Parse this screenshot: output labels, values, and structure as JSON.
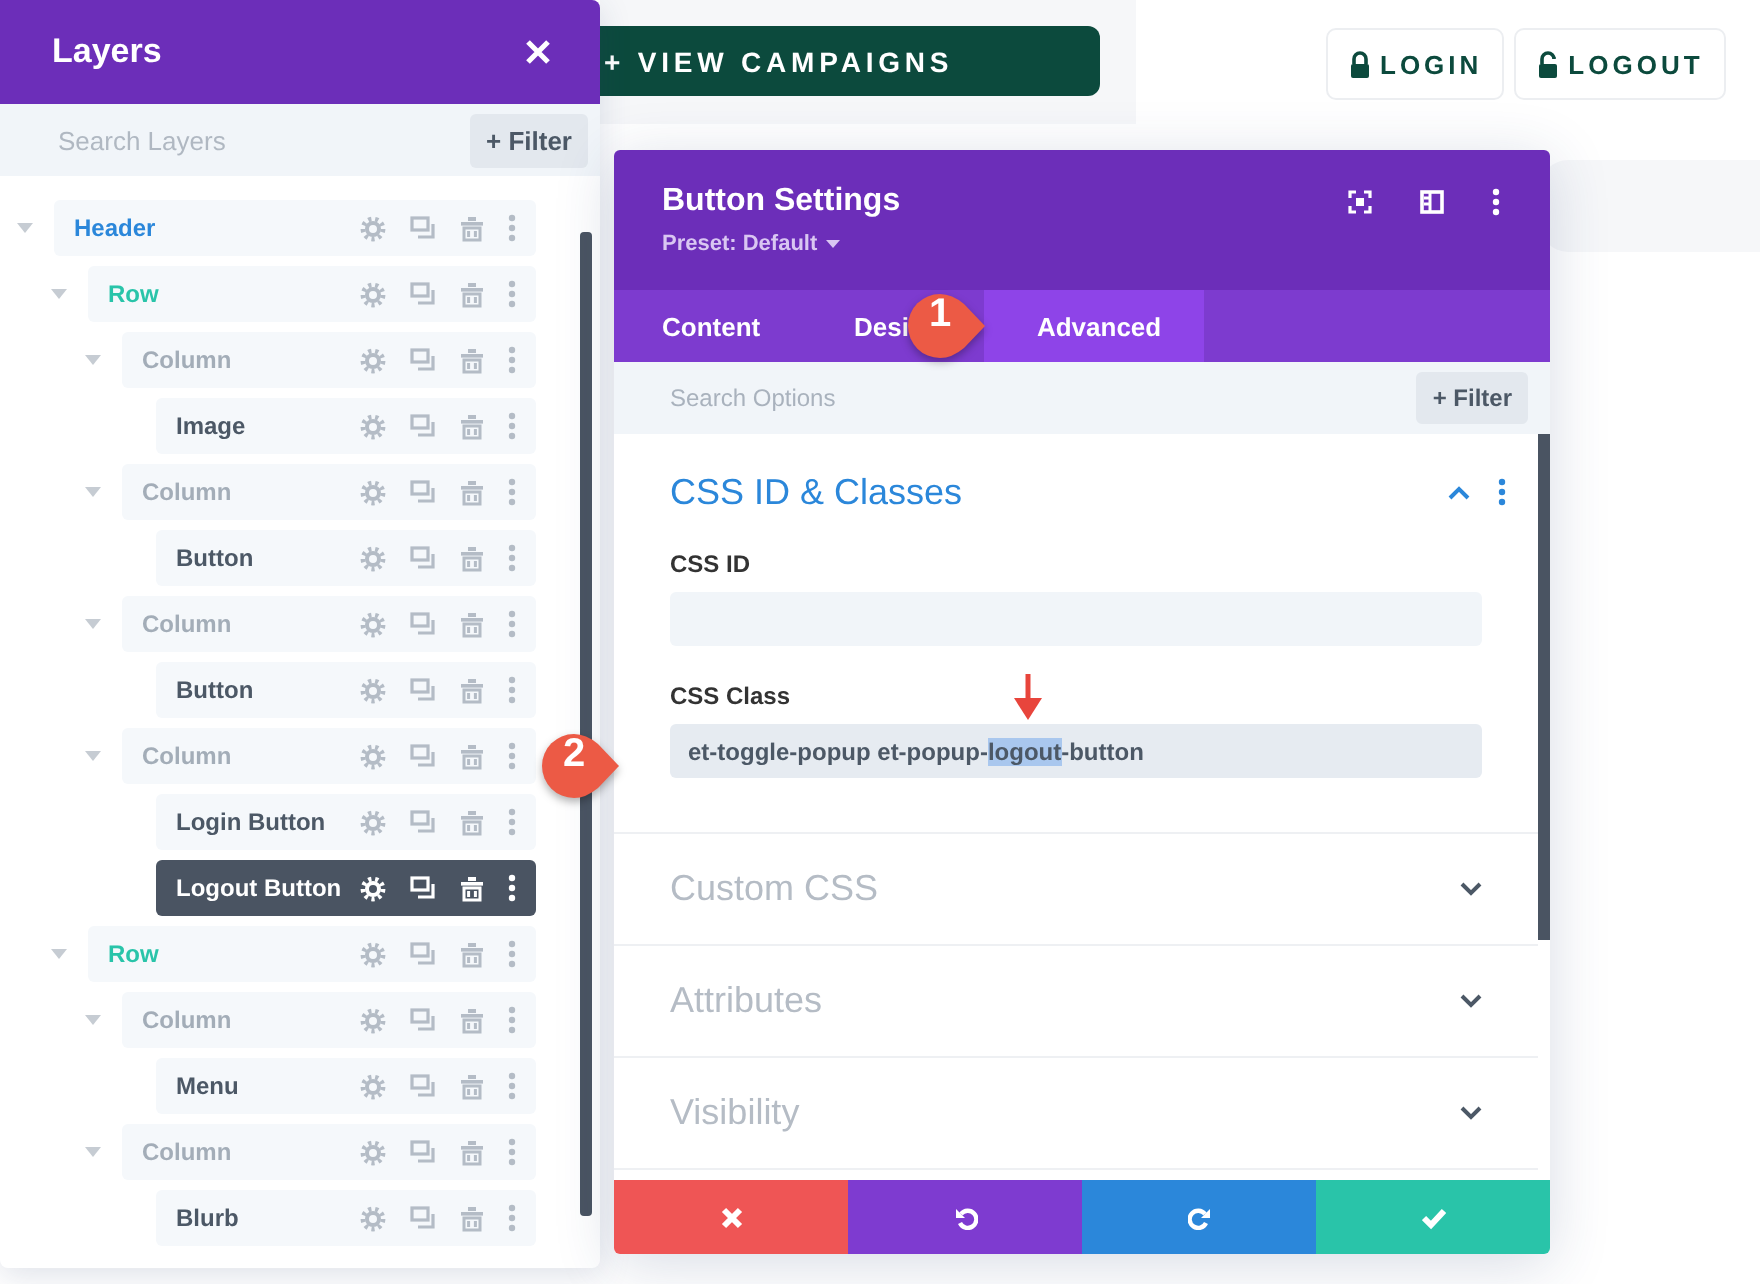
{
  "page": {
    "campaign_button": "+ VIEW CAMPAIGNS",
    "login_button": "LOGIN",
    "logout_button": "LOGOUT"
  },
  "layers_panel": {
    "title": "Layers",
    "search": {
      "placeholder": "Search Layers"
    },
    "filter_button": "+ Filter",
    "tree": [
      {
        "label": "Header",
        "kind": "section",
        "selected": false,
        "children": [
          {
            "label": "Row",
            "kind": "row",
            "selected": false,
            "children": [
              {
                "label": "Column",
                "kind": "column",
                "selected": false,
                "children": [
                  {
                    "label": "Image",
                    "kind": "module",
                    "selected": false
                  }
                ]
              },
              {
                "label": "Column",
                "kind": "column",
                "selected": false,
                "children": [
                  {
                    "label": "Button",
                    "kind": "module",
                    "selected": false
                  }
                ]
              },
              {
                "label": "Column",
                "kind": "column",
                "selected": false,
                "children": [
                  {
                    "label": "Button",
                    "kind": "module",
                    "selected": false
                  }
                ]
              },
              {
                "label": "Column",
                "kind": "column",
                "selected": false,
                "children": [
                  {
                    "label": "Login Button",
                    "kind": "module",
                    "selected": false
                  },
                  {
                    "label": "Logout Button",
                    "kind": "module",
                    "selected": true
                  }
                ]
              }
            ]
          },
          {
            "label": "Row",
            "kind": "row",
            "selected": false,
            "children": [
              {
                "label": "Column",
                "kind": "column",
                "selected": false,
                "children": [
                  {
                    "label": "Menu",
                    "kind": "module",
                    "selected": false
                  }
                ]
              },
              {
                "label": "Column",
                "kind": "column",
                "selected": false,
                "children": [
                  {
                    "label": "Blurb",
                    "kind": "module",
                    "selected": false
                  }
                ]
              }
            ]
          }
        ]
      }
    ]
  },
  "settings": {
    "title": "Button Settings",
    "preset": "Preset: Default",
    "tabs": [
      {
        "label": "Content",
        "selected": false
      },
      {
        "label": "Desi",
        "selected": false
      },
      {
        "label": "Advanced",
        "selected": true
      }
    ],
    "search": {
      "placeholder": "Search Options"
    },
    "filter_button": "+ Filter",
    "sections": [
      {
        "title": "CSS ID & Classes",
        "expanded": true,
        "fields": [
          {
            "label": "CSS ID"
          },
          {
            "label": "CSS Class",
            "value_parts": [
              {
                "text": "et-toggle-popup et-popup-",
                "selected": false
              },
              {
                "text": "logout",
                "selected": true
              },
              {
                "text": "-button",
                "selected": false
              }
            ]
          }
        ]
      },
      {
        "title": "Custom CSS",
        "expanded": false
      },
      {
        "title": "Attributes",
        "expanded": false
      },
      {
        "title": "Visibility",
        "expanded": false
      }
    ],
    "footer_buttons": [
      {
        "kind": "cancel"
      },
      {
        "kind": "undo"
      },
      {
        "kind": "redo"
      },
      {
        "kind": "save"
      }
    ]
  },
  "callouts": [
    {
      "number": "1"
    },
    {
      "number": "2"
    }
  ]
}
